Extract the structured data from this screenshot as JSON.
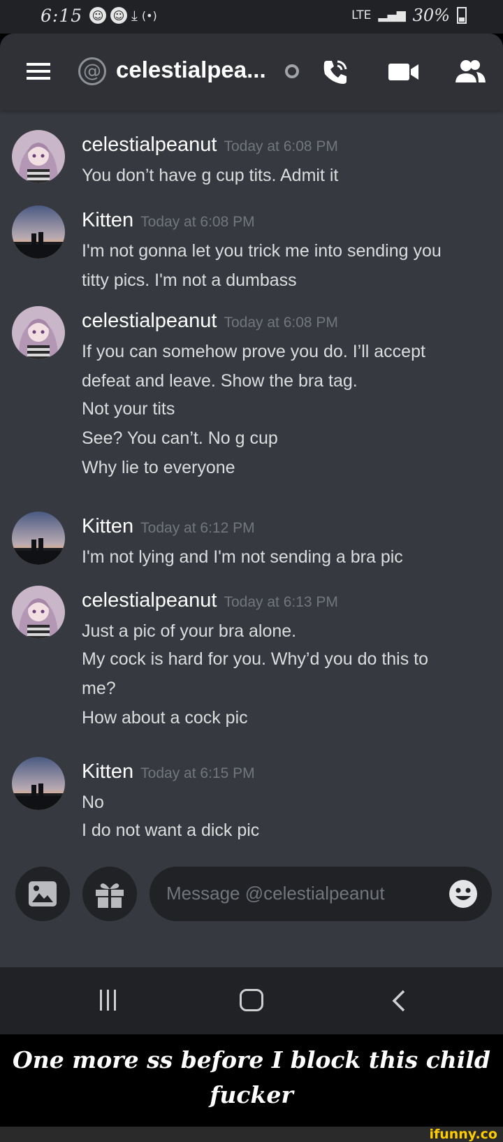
{
  "status_bar": {
    "time": "6:15",
    "network": "LTE",
    "battery": "30%"
  },
  "header": {
    "channel_title": "celestialpea...",
    "icons": [
      "menu-icon",
      "at-icon",
      "phone-call-icon",
      "video-camera-icon",
      "members-icon"
    ]
  },
  "messages": [
    {
      "author": "celestialpeanut",
      "timestamp": "Today at 6:08 PM",
      "avatar": "anime-avatar",
      "lines": [
        "You don’t have g cup tits. Admit it"
      ]
    },
    {
      "author": "Kitten",
      "timestamp": "Today at 6:08 PM",
      "avatar": "sunset-avatar",
      "lines": [
        "I'm not gonna let you trick me into sending you",
        "titty pics. I'm not a dumbass"
      ]
    },
    {
      "author": "celestialpeanut",
      "timestamp": "Today at 6:08 PM",
      "avatar": "anime-avatar",
      "lines": [
        "If you can somehow prove you do. I’ll accept",
        "defeat and leave. Show the bra tag.",
        "Not your tits",
        "See? You can’t. No g cup",
        "Why lie to everyone"
      ]
    },
    {
      "author": "Kitten",
      "timestamp": "Today at 6:12 PM",
      "avatar": "sunset-avatar",
      "lines": [
        "I'm not lying and I'm not sending a bra pic"
      ]
    },
    {
      "author": "celestialpeanut",
      "timestamp": "Today at 6:13 PM",
      "avatar": "anime-avatar",
      "lines": [
        "Just a pic of your bra alone.",
        "My cock is hard for you. Why’d you do this to",
        "me?",
        "How about a cock pic"
      ]
    },
    {
      "author": "Kitten",
      "timestamp": "Today at 6:15 PM",
      "avatar": "sunset-avatar",
      "lines": [
        "No",
        "I do not want a dick pic"
      ]
    }
  ],
  "composer": {
    "placeholder": "Message @celestialpeanut",
    "icons": [
      "image-icon",
      "gift-icon",
      "emoji-icon"
    ]
  },
  "caption": {
    "line1": "One more ss before I block this child",
    "line2": "fucker"
  },
  "watermark": "ifunny.co",
  "colors": {
    "background": "#36393f",
    "header": "#2f3136",
    "input": "#202225",
    "username": "#ffffff",
    "timestamp": "#72767d",
    "message_text": "#dcddde",
    "watermark": "#ffcc00"
  }
}
